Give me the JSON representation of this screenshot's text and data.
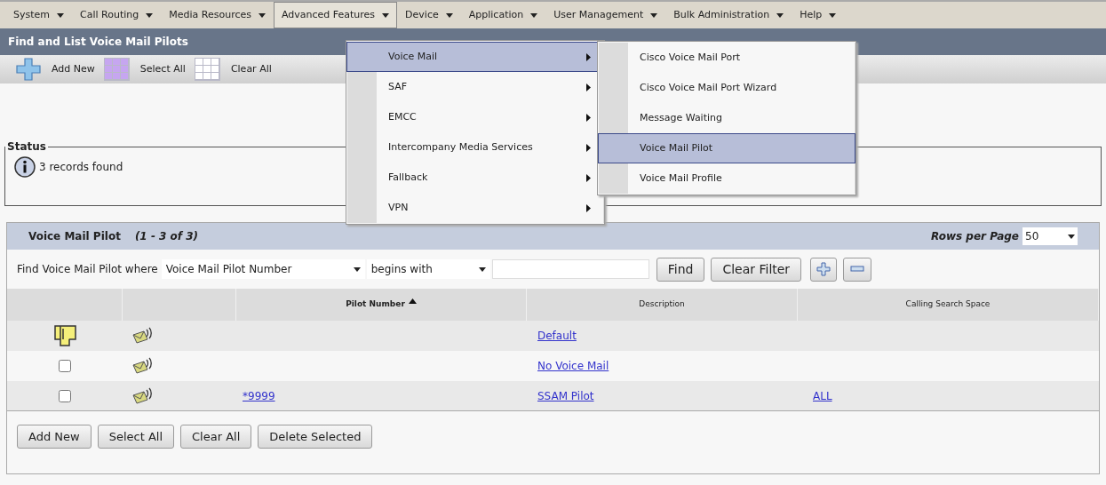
{
  "menu_bar": [
    {
      "label": "System",
      "selected": false
    },
    {
      "label": "Call Routing",
      "selected": false
    },
    {
      "label": "Media Resources",
      "selected": false
    },
    {
      "label": "Advanced Features",
      "selected": true
    },
    {
      "label": "Device",
      "selected": false
    },
    {
      "label": "Application",
      "selected": false
    },
    {
      "label": "User Management",
      "selected": false
    },
    {
      "label": "Bulk Administration",
      "selected": false
    },
    {
      "label": "Help",
      "selected": false
    }
  ],
  "menu": {
    "items": [
      {
        "label": "Voice Mail",
        "selected": true
      },
      {
        "label": "SAF",
        "selected": false
      },
      {
        "label": "EMCC",
        "selected": false
      },
      {
        "label": "Intercompany Media Services",
        "selected": false
      },
      {
        "label": "Fallback",
        "selected": false
      },
      {
        "label": "VPN",
        "selected": false
      }
    ]
  },
  "submenu": {
    "items": [
      {
        "label": "Cisco Voice Mail Port",
        "selected": false
      },
      {
        "label": "Cisco Voice Mail Port Wizard",
        "selected": false
      },
      {
        "label": "Message Waiting",
        "selected": false
      },
      {
        "label": "Voice Mail Pilot",
        "selected": true
      },
      {
        "label": "Voice Mail Profile",
        "selected": false
      }
    ]
  },
  "page_title": "Find and List Voice Mail Pilots",
  "toolbar": [
    {
      "kind": "add",
      "label": "Add New"
    },
    {
      "kind": "select_all",
      "label": "Select All"
    },
    {
      "kind": "clear_all",
      "label": "Clear All"
    }
  ],
  "status": {
    "legend": "Status",
    "message": "3 records found"
  },
  "list": {
    "title": "Voice Mail Pilot",
    "range": "(1 - 3 of 3)",
    "rows_per_page_label": "Rows per Page",
    "rows_per_page": "50",
    "filter": {
      "label": "Find Voice Mail Pilot where",
      "field": "Voice Mail Pilot Number",
      "operator": "begins with"
    },
    "filter_buttons": [
      "Find",
      "Clear Filter"
    ],
    "columns": [
      {
        "label": "Pilot Number",
        "sorted_ascending": true
      },
      {
        "label": "Description",
        "sorted_ascending": false
      },
      {
        "label": "Calling Search Space",
        "sorted_ascending": false
      }
    ],
    "rows": [
      {
        "kind": "default",
        "description": "Default"
      },
      {
        "kind": "checkbox",
        "checked": false,
        "description": "No Voice Mail"
      },
      {
        "kind": "checkbox",
        "checked": false,
        "pilot_number": "*9999",
        "description": "SSAM Pilot",
        "calling_search_space": "ALL"
      }
    ],
    "bottom_buttons": [
      "Add New",
      "Select All",
      "Clear All",
      "Delete Selected"
    ]
  }
}
